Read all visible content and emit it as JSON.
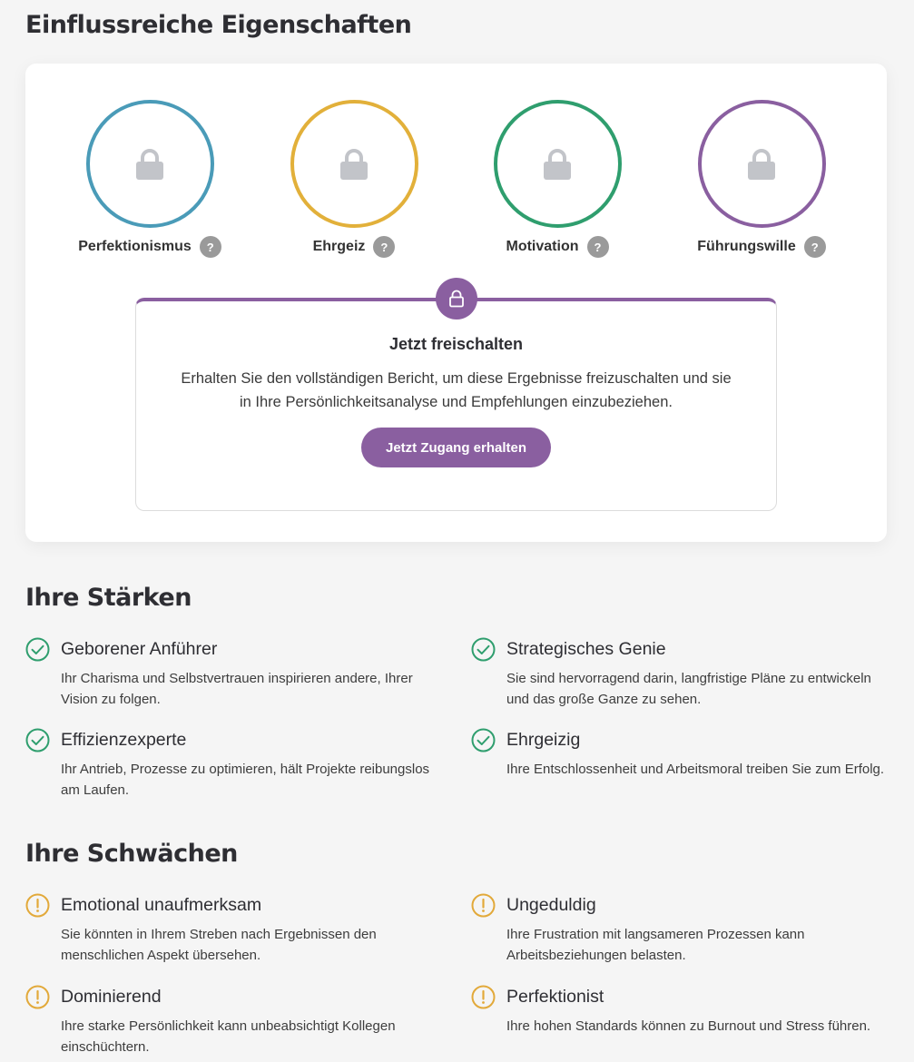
{
  "influential": {
    "heading": "Einflussreiche Eigenschaften",
    "traits": [
      {
        "label": "Perfektionismus",
        "color": "#4a9bb8"
      },
      {
        "label": "Ehrgeiz",
        "color": "#e2b03a"
      },
      {
        "label": "Motivation",
        "color": "#2f9e6e"
      },
      {
        "label": "Führungswille",
        "color": "#8a5fa0"
      }
    ],
    "help_glyph": "?",
    "unlock": {
      "title": "Jetzt freischalten",
      "text": "Erhalten Sie den vollständigen Bericht, um diese Ergebnisse freizuschalten und sie in Ihre Persönlichkeitsanalyse und Empfehlungen einzubeziehen.",
      "button": "Jetzt Zugang erhalten",
      "accent": "#8a5fa0"
    }
  },
  "strengths": {
    "heading": "Ihre Stärken",
    "icon": "check-circle-icon",
    "color": "#2f9e6e",
    "items": [
      {
        "title": "Geborener Anführer",
        "desc": "Ihr Charisma und Selbstvertrauen inspirieren andere, Ihrer Vision zu folgen."
      },
      {
        "title": "Strategisches Genie",
        "desc": "Sie sind hervorragend darin, langfristige Pläne zu entwickeln und das große Ganze zu sehen."
      },
      {
        "title": "Effizienzexperte",
        "desc": "Ihr Antrieb, Prozesse zu optimieren, hält Projekte reibungslos am Laufen."
      },
      {
        "title": "Ehrgeizig",
        "desc": "Ihre Entschlossenheit und Arbeitsmoral treiben Sie zum Erfolg."
      }
    ]
  },
  "weaknesses": {
    "heading": "Ihre Schwächen",
    "icon": "warning-circle-icon",
    "color": "#e2a93a",
    "items": [
      {
        "title": "Emotional unaufmerksam",
        "desc": "Sie könnten in Ihrem Streben nach Ergebnissen den menschlichen Aspekt übersehen."
      },
      {
        "title": "Ungeduldig",
        "desc": "Ihre Frustration mit langsameren Prozessen kann Arbeitsbeziehungen belasten."
      },
      {
        "title": "Dominierend",
        "desc": "Ihre starke Persönlichkeit kann unbeabsichtigt Kollegen einschüchtern."
      },
      {
        "title": "Perfektionist",
        "desc": "Ihre hohen Standards können zu Burnout und Stress führen."
      }
    ]
  }
}
